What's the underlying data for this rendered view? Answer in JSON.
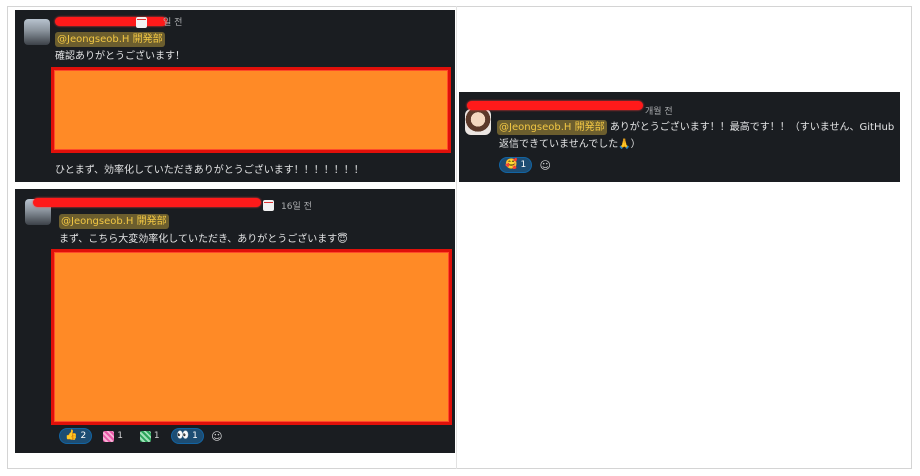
{
  "card_a": {
    "timestamp": "일 전",
    "mention": "@Jeongseob.H 開発部",
    "line1": "確認ありがとうございます！",
    "line2": "ひとまず、効率化していただきありがとうございます！！！！！！！"
  },
  "card_b": {
    "timestamp": "개월 전",
    "mention": "@Jeongseob.H 開発部",
    "text1": "ありがとうございます！！最高です！！（すいません、GitHub",
    "text2": "返信できていませんでした🙏）",
    "reactions": [
      {
        "emoji": "🥰",
        "count": "1"
      }
    ],
    "add_reaction_icon": "add-reaction-icon"
  },
  "card_c": {
    "timestamp": "16일 전",
    "mention": "@Jeongseob.H 開発部",
    "line1": "まず、こちら大変効率化していただき、ありがとうございます😇",
    "reactions": [
      {
        "emoji": "👍",
        "count": "2",
        "icon": "thumbs-up-icon"
      },
      {
        "emoji": "",
        "count": "1",
        "icon": "pink-custom-emoji-icon"
      },
      {
        "emoji": "",
        "count": "1",
        "icon": "green-custom-emoji-icon"
      },
      {
        "emoji": "👀",
        "count": "1",
        "icon": "eyes-icon"
      }
    ],
    "add_reaction_icon": "add-reaction-icon"
  },
  "colors": {
    "panel_bg": "#1a1d21",
    "mention_fg": "#f2c744",
    "redaction_fill": "#ff8a26",
    "redaction_border": "#e0100a"
  }
}
